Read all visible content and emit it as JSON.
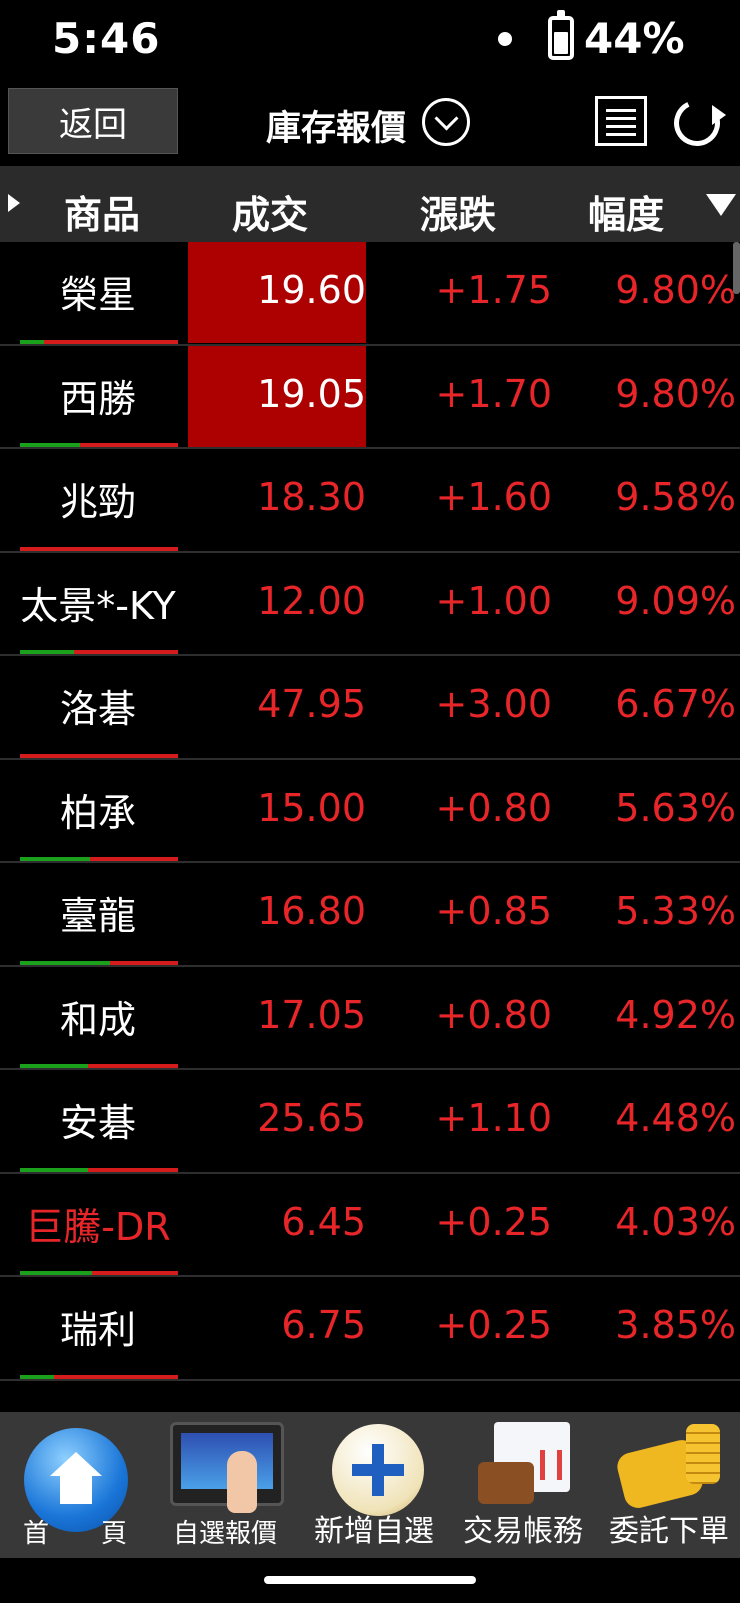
{
  "status_bar": {
    "time": "5:46",
    "battery": "44%"
  },
  "header": {
    "back_label": "返回",
    "title": "庫存報價"
  },
  "columns": {
    "product": "商品",
    "price": "成交",
    "change": "漲跌",
    "percent": "幅度"
  },
  "rows": [
    {
      "name": "榮星",
      "price": "19.60",
      "change": "+1.75",
      "percent": "9.80%"
    },
    {
      "name": "西勝",
      "price": "19.05",
      "change": "+1.70",
      "percent": "9.80%"
    },
    {
      "name": "兆勁",
      "price": "18.30",
      "change": "+1.60",
      "percent": "9.58%"
    },
    {
      "name": "太景*-KY",
      "price": "12.00",
      "change": "+1.00",
      "percent": "9.09%"
    },
    {
      "name": "洛碁",
      "price": "47.95",
      "change": "+3.00",
      "percent": "6.67%"
    },
    {
      "name": "柏承",
      "price": "15.00",
      "change": "+0.80",
      "percent": "5.63%"
    },
    {
      "name": "臺龍",
      "price": "16.80",
      "change": "+0.85",
      "percent": "5.33%"
    },
    {
      "name": "和成",
      "price": "17.05",
      "change": "+0.80",
      "percent": "4.92%"
    },
    {
      "name": "安碁",
      "price": "25.65",
      "change": "+1.10",
      "percent": "4.48%"
    },
    {
      "name": "巨騰-DR",
      "price": "6.45",
      "change": "+0.25",
      "percent": "4.03%"
    },
    {
      "name": "瑞利",
      "price": "6.75",
      "change": "+0.25",
      "percent": "3.85%"
    }
  ],
  "bottom_nav": {
    "home": "首　　頁",
    "watchlist": "自選報價",
    "add_watch": "新增自選",
    "account": "交易帳務",
    "order": "委託下單"
  },
  "colors": {
    "up": "#e8262a",
    "limit_up_bg": "#ad0000",
    "header_bg": "#2b2b2b",
    "nav_bg": "#383838"
  },
  "icons": [
    "battery-icon",
    "dropdown-icon",
    "list-icon",
    "refresh-icon",
    "home-icon",
    "watchlist-icon",
    "add-icon",
    "account-icon",
    "order-icon"
  ]
}
